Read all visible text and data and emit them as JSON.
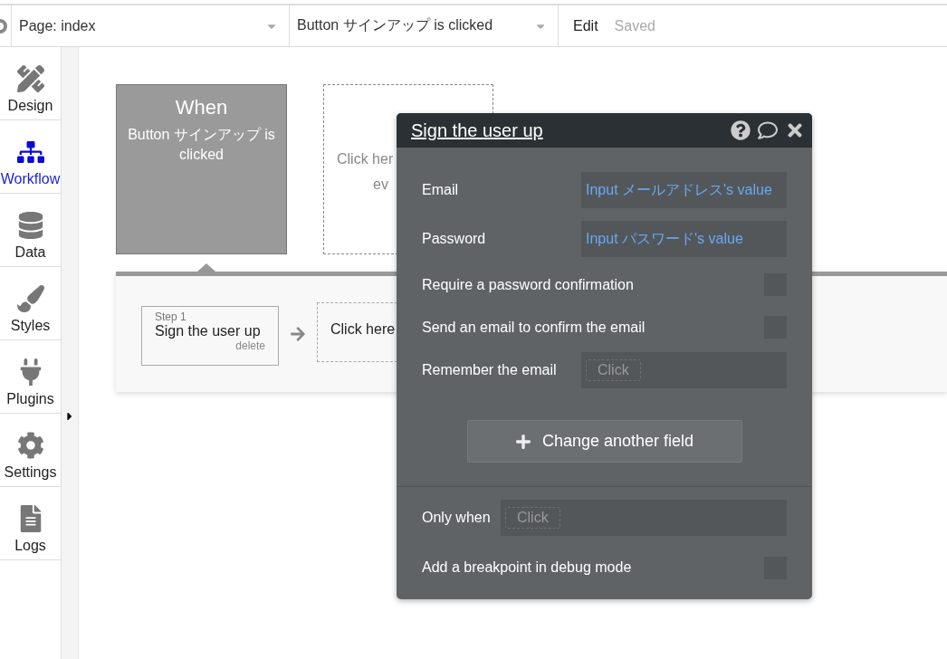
{
  "top_bar": {
    "page_dropdown": "Page: index",
    "event_dropdown": "Button サインアップ is clicked",
    "edit": "Edit",
    "status": "Saved"
  },
  "sidebar": {
    "items": [
      {
        "label": "Design",
        "selected": false
      },
      {
        "label": "Workflow",
        "selected": true
      },
      {
        "label": "Data",
        "selected": false
      },
      {
        "label": "Styles",
        "selected": false
      },
      {
        "label": "Plugins",
        "selected": false
      },
      {
        "label": "Settings",
        "selected": false
      },
      {
        "label": "Logs",
        "selected": false
      }
    ]
  },
  "canvas": {
    "event_card": {
      "title": "When",
      "text": "Button サインアップ is clicked"
    },
    "add_event_card": {
      "lines": [
        "Click her",
        "ev"
      ]
    },
    "actions": [
      {
        "step": "Step 1",
        "title": "Sign the user up",
        "delete": "delete"
      }
    ],
    "add_action": "Click here"
  },
  "popup": {
    "title": "Sign the user up",
    "fields": [
      {
        "kind": "value",
        "label": "Email",
        "value": "Input メールアドレス's value"
      },
      {
        "kind": "value",
        "label": "Password",
        "value": "Input パスワード's value"
      },
      {
        "kind": "checkbox",
        "label": "Require a password confirmation",
        "checked": false
      },
      {
        "kind": "checkbox",
        "label": "Send an email to confirm the email",
        "checked": false
      },
      {
        "kind": "expression",
        "label": "Remember the email",
        "placeholder": "Click"
      }
    ],
    "add_button": "Change another field",
    "condition": {
      "label": "Only when",
      "placeholder": "Click"
    },
    "breakpoint": {
      "label": "Add a breakpoint in debug mode",
      "checked": false
    }
  }
}
